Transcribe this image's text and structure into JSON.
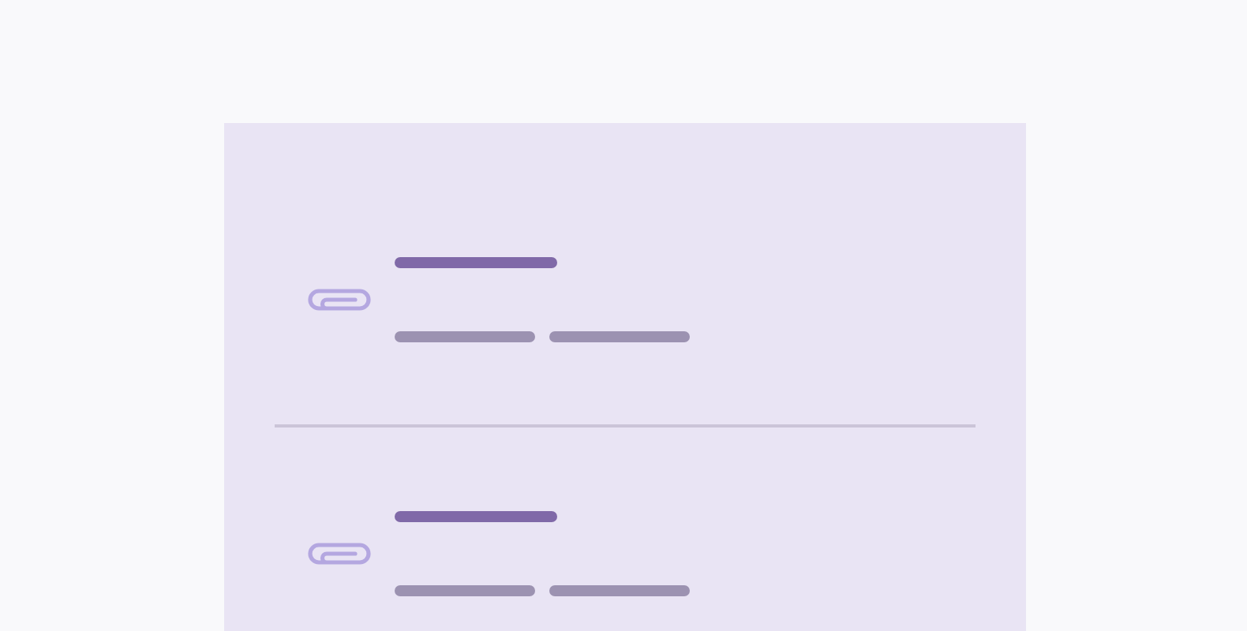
{
  "attachments": [
    {
      "kind": "skeleton"
    },
    {
      "kind": "skeleton"
    }
  ]
}
